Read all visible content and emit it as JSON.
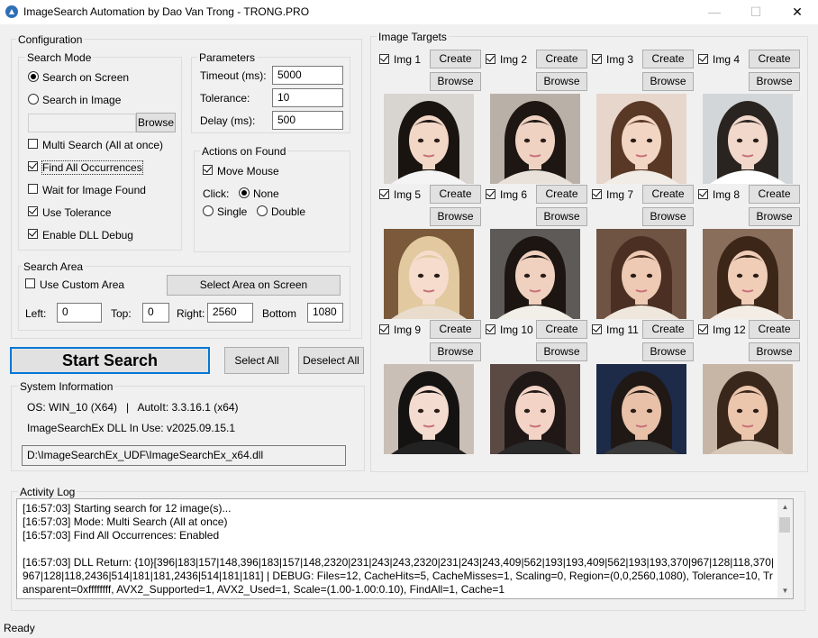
{
  "window": {
    "title": "ImageSearch Automation by Dao Van Trong - TRONG.PRO",
    "minimize_glyph": "—",
    "maximize_glyph": "☐",
    "close_glyph": "✕"
  },
  "config": {
    "group_label": "Configuration",
    "search_mode": {
      "label": "Search Mode",
      "search_on_screen": "Search on Screen",
      "search_in_image": "Search in Image",
      "image_path_value": "",
      "browse_label": "Browse",
      "multi_search": "Multi Search (All at once)",
      "find_all": "Find All Occurrences",
      "wait_for_image": "Wait for Image Found",
      "use_tolerance": "Use Tolerance",
      "enable_dll_debug": "Enable DLL Debug"
    },
    "parameters": {
      "label": "Parameters",
      "timeout_label": "Timeout (ms):",
      "timeout_value": "5000",
      "tolerance_label": "Tolerance:",
      "tolerance_value": "10",
      "delay_label": "Delay (ms):",
      "delay_value": "500"
    },
    "actions": {
      "label": "Actions on Found",
      "move_mouse": "Move Mouse",
      "click_label": "Click:",
      "none": "None",
      "single": "Single",
      "double": "Double"
    },
    "search_area": {
      "label": "Search Area",
      "use_custom_area": "Use Custom Area",
      "select_area_button": "Select Area on Screen",
      "left_label": "Left:",
      "left_value": "0",
      "top_label": "Top:",
      "top_value": "0",
      "right_label": "Right:",
      "right_value": "2560",
      "bottom_label": "Bottom",
      "bottom_value": "1080"
    }
  },
  "buttons": {
    "start_search": "Start Search",
    "select_all": "Select All",
    "deselect_all": "Deselect All"
  },
  "system_info": {
    "label": "System Information",
    "os_line": "OS: WIN_10 (X64)   |   AutoIt: 3.3.16.1 (x64)",
    "dll_line": "ImageSearchEx DLL In Use: v2025.09.15.1",
    "dll_path": "D:\\ImageSearchEx_UDF\\ImageSearchEx_x64.dll"
  },
  "image_targets": {
    "label": "Image Targets",
    "create_label": "Create",
    "browse_label": "Browse",
    "items": [
      {
        "label": "Img 1",
        "checked": true,
        "hair": "#1a1410",
        "bg": "#d8d4cf",
        "skin": "#f2d6c6",
        "top": "#f4f4f4"
      },
      {
        "label": "Img 2",
        "checked": true,
        "hair": "#1d1612",
        "bg": "#b9b1a8",
        "skin": "#efd2c2",
        "top": "#e8e2da"
      },
      {
        "label": "Img 3",
        "checked": true,
        "hair": "#5a3826",
        "bg": "#e6d6cc",
        "skin": "#f3d5c3",
        "top": "#f2ece6"
      },
      {
        "label": "Img 4",
        "checked": true,
        "hair": "#2a2420",
        "bg": "#d3d6d8",
        "skin": "#f1d8ca",
        "top": "#ffffff"
      },
      {
        "label": "Img 5",
        "checked": true,
        "hair": "#e2c9a0",
        "bg": "#7a5a3a",
        "skin": "#f5dccd",
        "top": "#e9dccc"
      },
      {
        "label": "Img 6",
        "checked": true,
        "hair": "#1c1512",
        "bg": "#5e5a57",
        "skin": "#f0d0bf",
        "top": "#f2eee8"
      },
      {
        "label": "Img 7",
        "checked": true,
        "hair": "#4a2f22",
        "bg": "#6f5444",
        "skin": "#eec9b3",
        "top": "#efe6dc"
      },
      {
        "label": "Img 8",
        "checked": true,
        "hair": "#3c2618",
        "bg": "#8a6e5c",
        "skin": "#f0cdb7",
        "top": "#f3ede6"
      },
      {
        "label": "Img 9",
        "checked": true,
        "hair": "#151212",
        "bg": "#c9bfb6",
        "skin": "#f4dbcf",
        "top": "#222222"
      },
      {
        "label": "Img 10",
        "checked": true,
        "hair": "#201816",
        "bg": "#5b4a44",
        "skin": "#f2d3c6",
        "top": "#2a2a2a"
      },
      {
        "label": "Img 11",
        "checked": true,
        "hair": "#1f1814",
        "bg": "#1d2a48",
        "skin": "#e8c1a8",
        "top": "#3a3a3a"
      },
      {
        "label": "Img 12",
        "checked": true,
        "hair": "#3a271c",
        "bg": "#c7b6a6",
        "skin": "#ecc5ad",
        "top": "#d8c8b8"
      }
    ]
  },
  "activity_log": {
    "label": "Activity Log",
    "text": "[16:57:03] Starting search for 12 image(s)...\n[16:57:03] Mode: Multi Search (All at once)\n[16:57:03] Find All Occurrences: Enabled\n\n[16:57:03] DLL Return: {10}[396|183|157|148,396|183|157|148,2320|231|243|243,2320|231|243|243,409|562|193|193,409|562|193|193,370|967|128|118,370|967|128|118,2436|514|181|181,2436|514|181|181] | DEBUG: Files=12, CacheHits=5, CacheMisses=1, Scaling=0, Region=(0,0,2560,1080), Tolerance=10, Transparent=0xffffffff, AVX2_Supported=1, AVX2_Used=1, Scale=(1.00-1.00:0.10), FindAll=1, Cache=1",
    "scroll_up": "▲",
    "scroll_down": "▼"
  },
  "status_bar": {
    "text": "Ready"
  }
}
